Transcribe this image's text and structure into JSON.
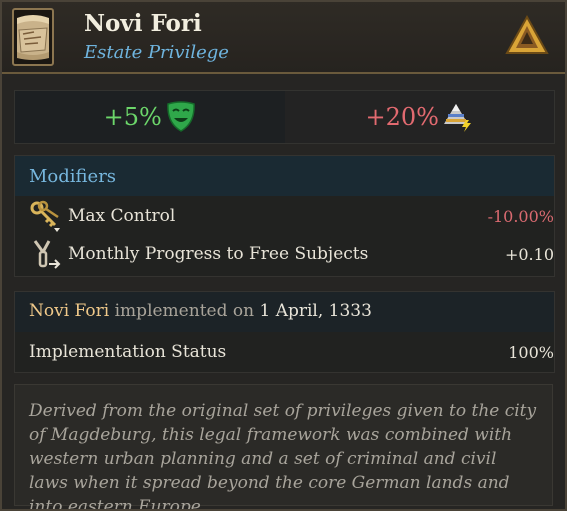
{
  "header": {
    "title": "Novi Fori",
    "subtitle": "Estate Privilege",
    "privilege_icon": "scroll-map-icon",
    "estate_icon": "pyramid-estate-icon"
  },
  "effects": {
    "satisfaction": {
      "value": "+5%",
      "icon": "happy-mask-icon",
      "color": "#6cd66a"
    },
    "power": {
      "value": "+20%",
      "icon": "estate-power-pyramid-icon",
      "color": "#e26a70"
    }
  },
  "modifiers": {
    "title": "Modifiers",
    "rows": [
      {
        "label": "Max Control",
        "value": "-10.00%",
        "icon": "keys-icon",
        "color": "#d96a70"
      },
      {
        "label": "Monthly Progress to Free Subjects",
        "value": "+0.10",
        "icon": "broken-chain-icon",
        "color": "#e8e4d8"
      }
    ]
  },
  "implemented": {
    "name": "Novi Fori",
    "middle": "implemented on",
    "date": "1 April, 1333",
    "status_label": "Implementation Status",
    "status_value": "100%"
  },
  "description": "Derived from the original set of privileges given to the city of Magdeburg, this legal framework was combined with western urban planning and a set of criminal and civil laws when it spread beyond the core German lands and into eastern Europe."
}
